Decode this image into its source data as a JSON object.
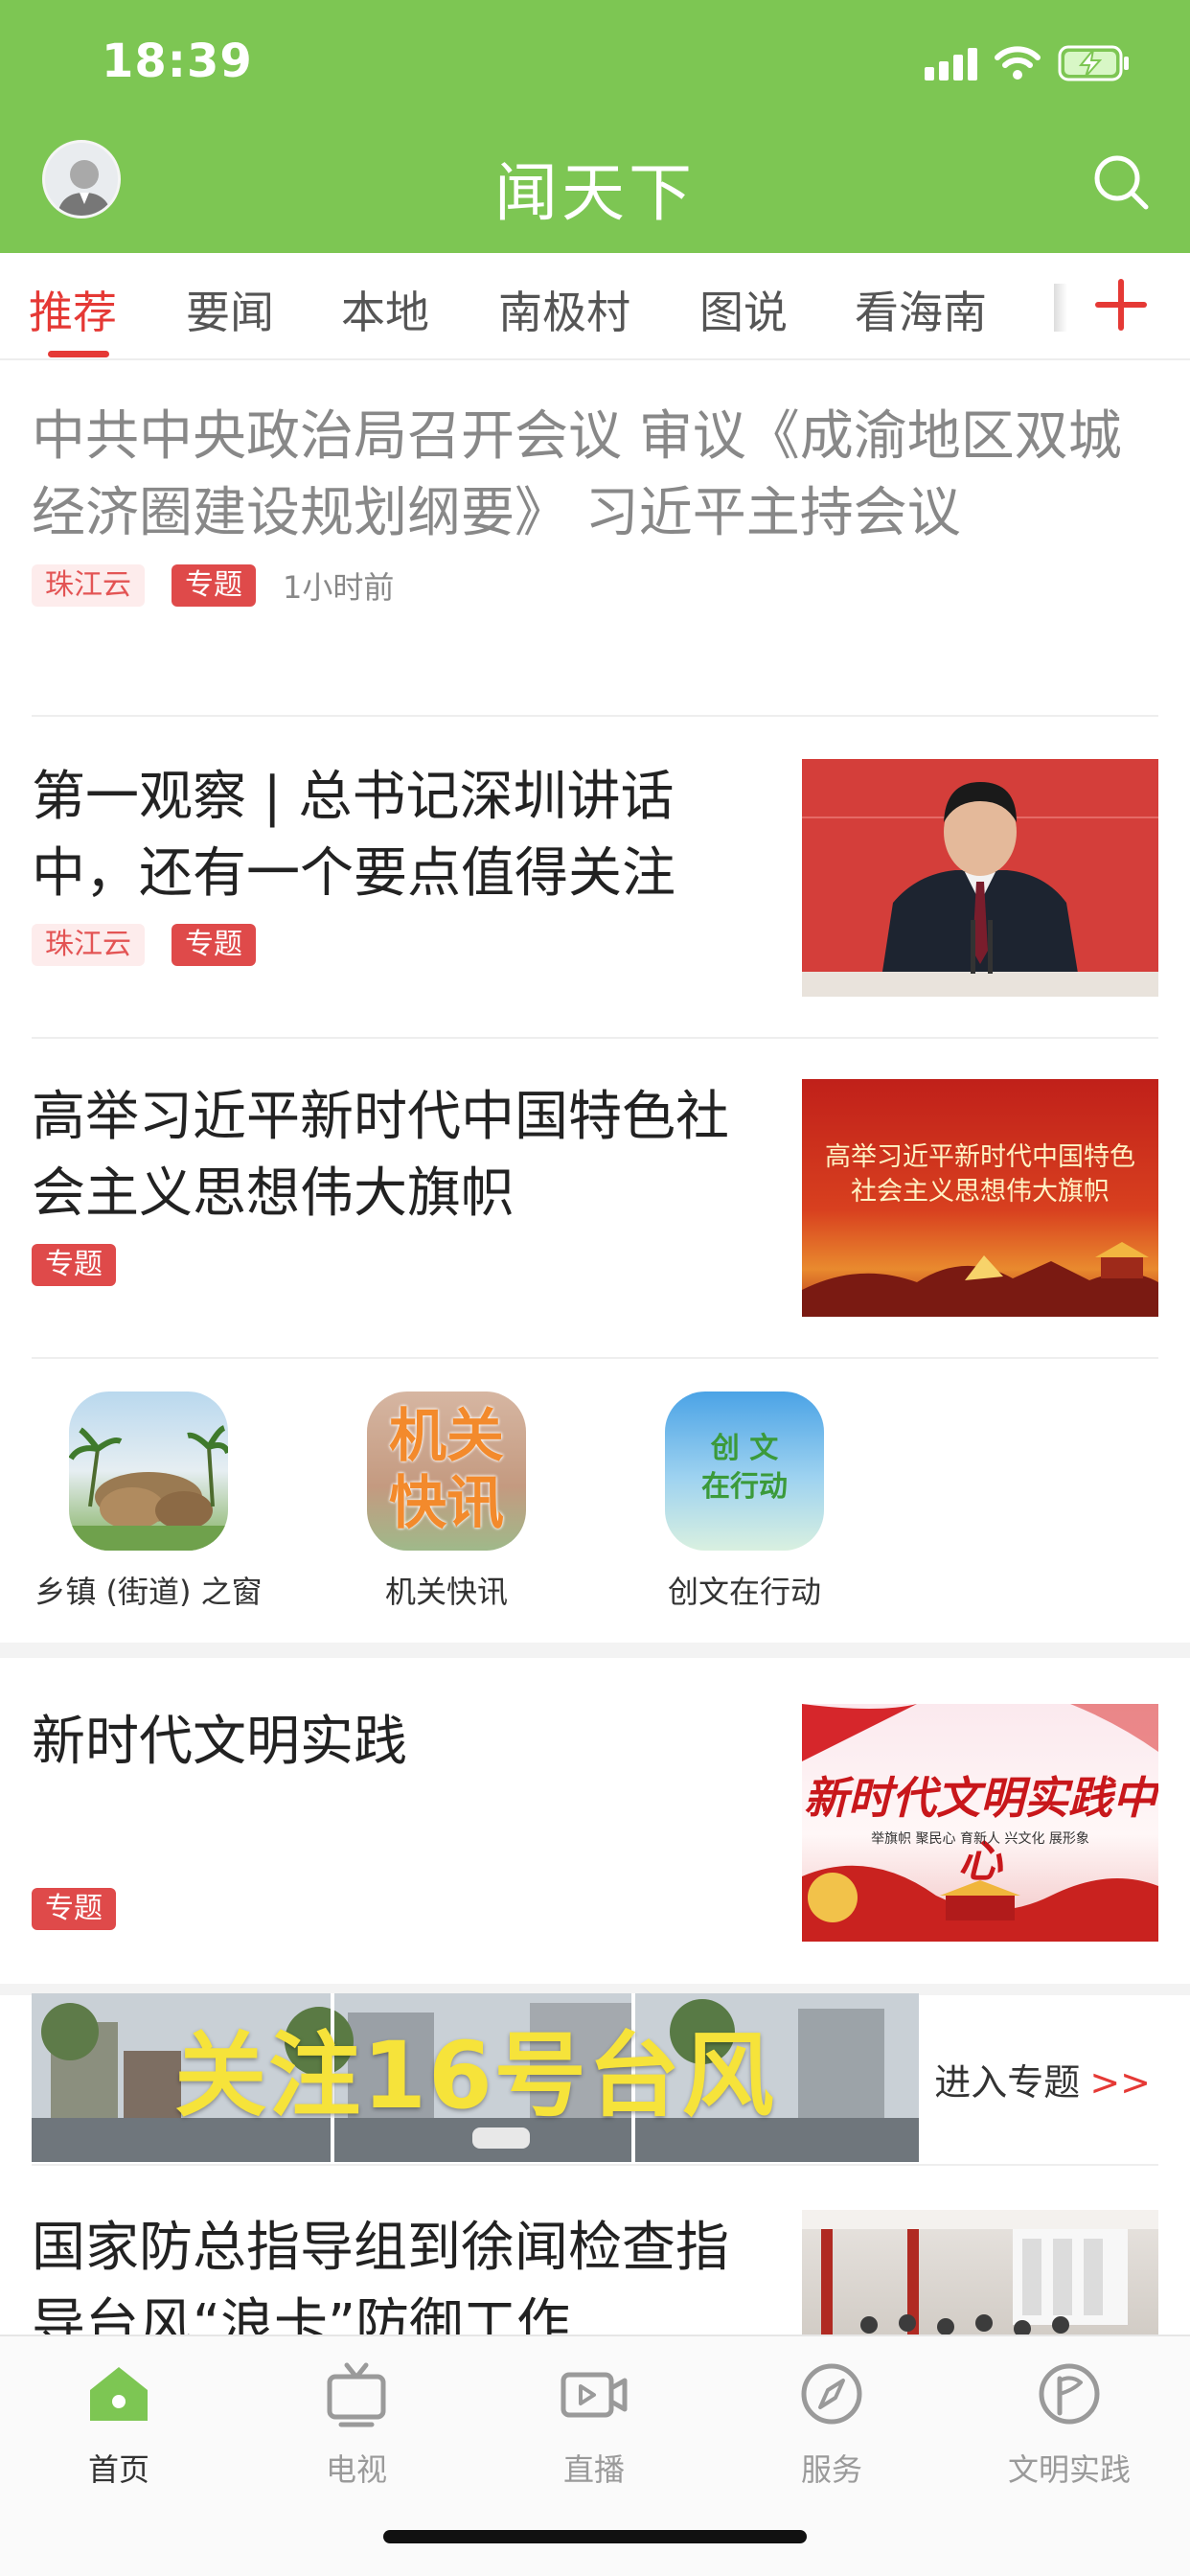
{
  "status_bar": {
    "time": "18:39"
  },
  "header": {
    "title": "闻天下"
  },
  "tabs": [
    {
      "label": "推荐",
      "active": true
    },
    {
      "label": "要闻"
    },
    {
      "label": "本地"
    },
    {
      "label": "南极村"
    },
    {
      "label": "图说"
    },
    {
      "label": "看海南"
    }
  ],
  "feed": {
    "items": [
      {
        "title": "中共中央政治局召开会议 审议《成渝地区双城经济圈建设规划纲要》 习近平主持会议",
        "source": "珠江云",
        "tag": "专题",
        "time": "1小时前"
      },
      {
        "title": "第一观察 | 总书记深圳讲话中，还有一个要点值得关注",
        "source": "珠江云",
        "tag": "专题"
      },
      {
        "title": "高举习近平新时代中国特色社会主义思想伟大旗帜",
        "tag": "专题",
        "image_text_1": "高举习近平新时代中国特色",
        "image_text_2": "社会主义思想伟大旗帜"
      },
      {
        "title": "新时代文明实践",
        "tag": "专题",
        "image_text": "新时代文明实践中心",
        "image_subtext": "举旗帜 聚民心 育新人 兴文化 展形象"
      },
      {
        "title": "国家防总指导组到徐闻检查指导台风“浪卡”防御工作"
      }
    ]
  },
  "quick_links": [
    {
      "label": "乡镇 (街道) 之窗"
    },
    {
      "label": "机关快讯",
      "icon_text_1": "机关",
      "icon_text_2": "快讯"
    },
    {
      "label": "创文在行动",
      "icon_text_1": "创  文",
      "icon_text_2": "在行动"
    }
  ],
  "banner": {
    "image_text": "关注16号台风",
    "link_label": "进入专题",
    "link_arrows": ">>"
  },
  "bottom_nav": [
    {
      "label": "首页",
      "icon": "home-icon",
      "active": true
    },
    {
      "label": "电视",
      "icon": "tv-icon"
    },
    {
      "label": "直播",
      "icon": "live-video-icon"
    },
    {
      "label": "服务",
      "icon": "compass-icon"
    },
    {
      "label": "文明实践",
      "icon": "flag-icon"
    }
  ],
  "colors": {
    "brand_green": "#7dc653",
    "accent_red": "#e53935",
    "tag_red": "#df4a4a"
  }
}
